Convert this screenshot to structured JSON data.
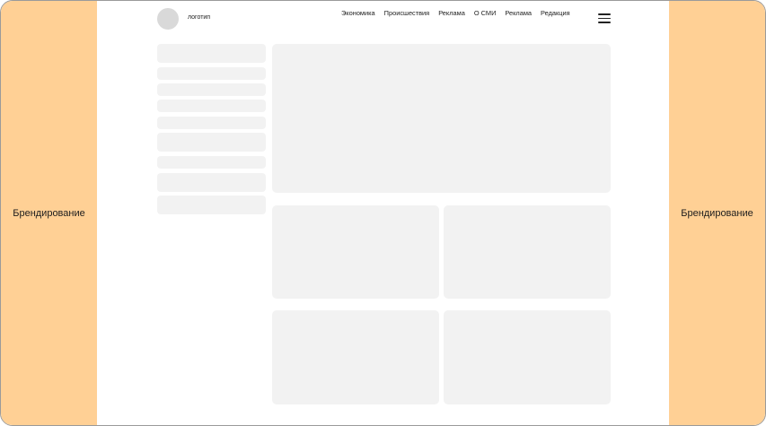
{
  "branding": {
    "left_label": "Брендирование",
    "right_label": "Брендирование"
  },
  "header": {
    "logo_text": "логотип",
    "nav": [
      "Экономика",
      "Происшествия",
      "Реклама",
      "О СМИ",
      "Реклама",
      "Редакция"
    ]
  },
  "colors": {
    "branding": "#ffd095",
    "placeholder": "#f2f2f2",
    "logo_placeholder": "#d9d9d9"
  }
}
